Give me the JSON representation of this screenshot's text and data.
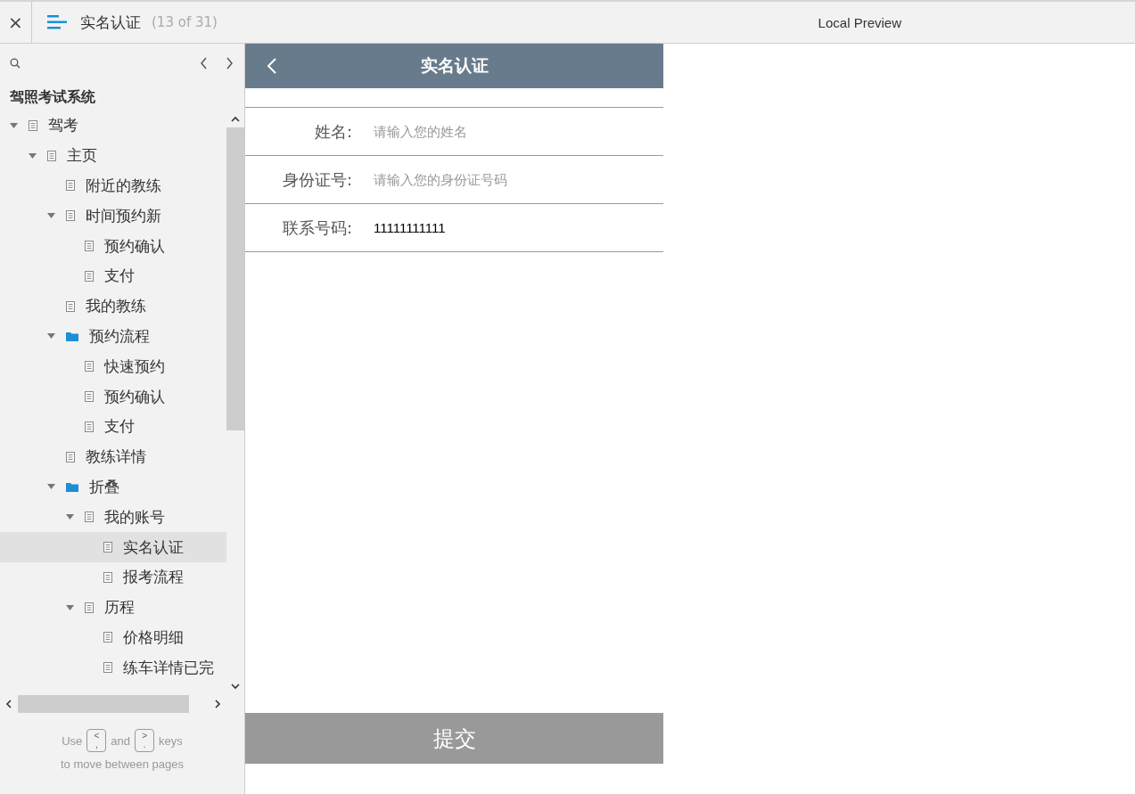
{
  "toolbar": {
    "close": "×",
    "page_title": "实名认证",
    "page_count": "(13 of 31)",
    "preview_label": "Local Preview"
  },
  "sidebar": {
    "project_title": "驾照考试系统",
    "tree": [
      {
        "label": "驾考",
        "kind": "page",
        "expanded": true,
        "selected": false,
        "children": [
          {
            "label": "主页",
            "kind": "page",
            "expanded": true,
            "selected": false,
            "children": [
              {
                "label": "附近的教练",
                "kind": "page",
                "selected": false
              },
              {
                "label": "时间预约新",
                "kind": "page",
                "expanded": true,
                "selected": false,
                "children": [
                  {
                    "label": "预约确认",
                    "kind": "page",
                    "selected": false
                  },
                  {
                    "label": "支付",
                    "kind": "page",
                    "selected": false
                  }
                ]
              },
              {
                "label": "我的教练",
                "kind": "page",
                "selected": false
              },
              {
                "label": "预约流程",
                "kind": "folder",
                "expanded": true,
                "selected": false,
                "children": [
                  {
                    "label": "快速预约",
                    "kind": "page",
                    "selected": false
                  },
                  {
                    "label": "预约确认",
                    "kind": "page",
                    "selected": false
                  },
                  {
                    "label": "支付",
                    "kind": "page",
                    "selected": false
                  }
                ]
              },
              {
                "label": "教练详情",
                "kind": "page",
                "selected": false
              },
              {
                "label": "折叠",
                "kind": "folder",
                "expanded": true,
                "selected": false,
                "children": [
                  {
                    "label": "我的账号",
                    "kind": "page",
                    "expanded": true,
                    "selected": false,
                    "children": [
                      {
                        "label": "实名认证",
                        "kind": "page",
                        "selected": true
                      },
                      {
                        "label": "报考流程",
                        "kind": "page",
                        "selected": false
                      }
                    ]
                  },
                  {
                    "label": "历程",
                    "kind": "page",
                    "expanded": true,
                    "selected": false,
                    "children": [
                      {
                        "label": "价格明细",
                        "kind": "page",
                        "selected": false
                      },
                      {
                        "label": "练车详情已完",
                        "kind": "page",
                        "selected": false
                      }
                    ]
                  }
                ]
              }
            ]
          }
        ]
      }
    ],
    "footer": {
      "before": "Use",
      "key_prev": [
        "<",
        ","
      ],
      "middle": "and",
      "key_next": [
        ">",
        "."
      ],
      "after": "keys",
      "line2": "to move between pages"
    }
  },
  "screen": {
    "title": "实名认证",
    "fields": [
      {
        "label": "姓名:",
        "placeholder": "请输入您的姓名"
      },
      {
        "label": "身份证号:",
        "placeholder": "请输入您的身份证号码"
      },
      {
        "label": "联系号码:",
        "value": "11111111111"
      }
    ],
    "submit": "提交"
  }
}
